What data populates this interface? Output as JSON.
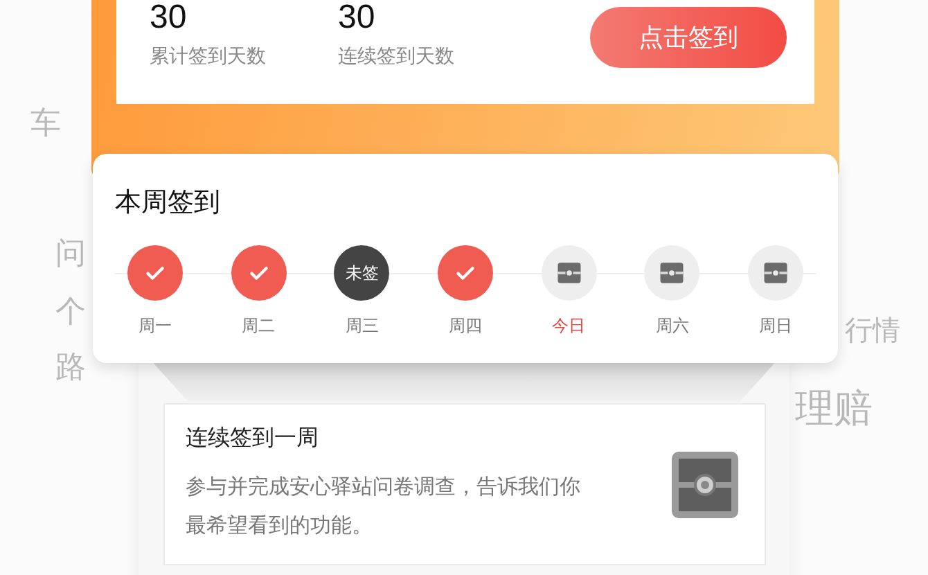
{
  "background_words": [
    {
      "text": "车"
    },
    {
      "text": "问"
    },
    {
      "text": "个"
    },
    {
      "text": "路"
    },
    {
      "text": "行情"
    },
    {
      "text": "理赔"
    }
  ],
  "summary": {
    "stats": [
      {
        "value": "30",
        "label": "累计签到天数"
      },
      {
        "value": "30",
        "label": "连续签到天数"
      }
    ],
    "button": "点击签到"
  },
  "week": {
    "title": "本周签到",
    "days": [
      {
        "label": "周一",
        "kind": "signed",
        "selected": false
      },
      {
        "label": "周二",
        "kind": "signed",
        "selected": false
      },
      {
        "label": "周三",
        "kind": "missed",
        "badge": "未签",
        "selected": false
      },
      {
        "label": "周四",
        "kind": "signed",
        "selected": false
      },
      {
        "label": "今日",
        "kind": "chest",
        "selected": true
      },
      {
        "label": "周六",
        "kind": "chest",
        "selected": false
      },
      {
        "label": "周日",
        "kind": "chest",
        "selected": false
      }
    ]
  },
  "reward": {
    "title": "连续签到一周",
    "description": "参与并完成安心驿站问卷调查，告诉我们你最希望看到的功能。"
  }
}
